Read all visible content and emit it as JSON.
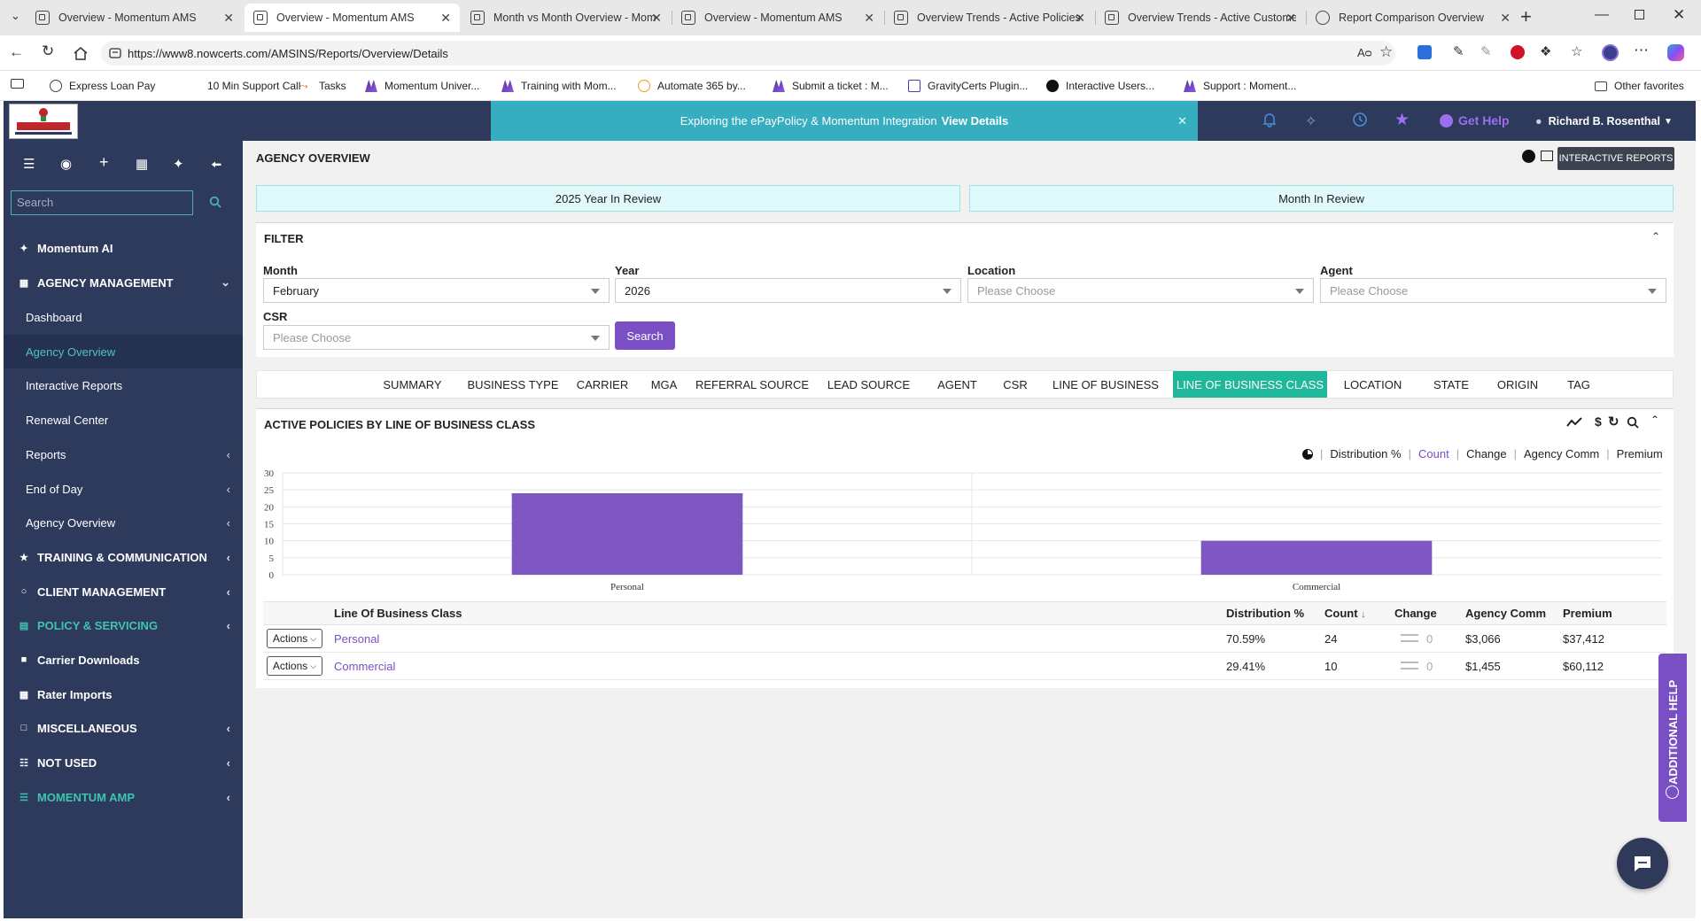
{
  "browser": {
    "tabs": [
      {
        "title": "Overview - Momentum AMS",
        "active": false
      },
      {
        "title": "Overview - Momentum AMS",
        "active": true
      },
      {
        "title": "Month vs Month Overview - Mom",
        "active": false
      },
      {
        "title": "Overview - Momentum AMS",
        "active": false
      },
      {
        "title": "Overview Trends - Active Policies",
        "active": false
      },
      {
        "title": "Overview Trends - Active Custome",
        "active": false
      },
      {
        "title": "Report Comparison Overview",
        "active": false
      }
    ],
    "url": "https://www8.nowcerts.com/AMSINS/Reports/Overview/Details",
    "favorites": [
      "Express Loan Pay",
      "10 Min Support Call",
      "Tasks",
      "Momentum Univer...",
      "Training with Mom...",
      "Automate 365 by...",
      "Submit a ticket : M...",
      "GravityCerts Plugin...",
      "Interactive Users...",
      "Support : Moment..."
    ],
    "other_favorites": "Other favorites"
  },
  "sidebar": {
    "search_placeholder": "Search",
    "items": [
      {
        "label": "Momentum AI",
        "type": "section",
        "icon": "sparkle-icon"
      },
      {
        "label": "AGENCY MANAGEMENT",
        "type": "section",
        "icon": "grid-icon",
        "chevron": "down"
      },
      {
        "label": "Dashboard",
        "type": "sub"
      },
      {
        "label": "Agency Overview",
        "type": "sub",
        "selected": true
      },
      {
        "label": "Interactive Reports",
        "type": "sub"
      },
      {
        "label": "Renewal Center",
        "type": "sub"
      },
      {
        "label": "Reports",
        "type": "sub",
        "chevron": "left"
      },
      {
        "label": "End of Day",
        "type": "sub",
        "chevron": "left"
      },
      {
        "label": "Agency Overview",
        "type": "sub",
        "chevron": "left"
      },
      {
        "label": "TRAINING & COMMUNICATION",
        "type": "section",
        "icon": "trophy-icon",
        "chevron": "left"
      },
      {
        "label": "CLIENT MANAGEMENT",
        "type": "section",
        "icon": "circle-icon",
        "chevron": "left"
      },
      {
        "label": "POLICY & SERVICING",
        "type": "section",
        "icon": "document-icon",
        "chevron": "left",
        "teal": true
      },
      {
        "label": "Carrier Downloads",
        "type": "section",
        "icon": "file-icon"
      },
      {
        "label": "Rater Imports",
        "type": "section",
        "icon": "calculator-icon"
      },
      {
        "label": "MISCELLANEOUS",
        "type": "section",
        "icon": "copy-icon",
        "chevron": "left"
      },
      {
        "label": "NOT USED",
        "type": "section",
        "icon": "sitemap-icon",
        "chevron": "left"
      },
      {
        "label": "MOMENTUM AMP",
        "type": "section",
        "icon": "list-icon",
        "chevron": "left",
        "teal": true
      }
    ]
  },
  "topbar": {
    "banner_text": "Exploring the ePayPolicy & Momentum Integration",
    "banner_link": "View Details",
    "get_help": "Get Help",
    "user": "Richard B. Rosenthal"
  },
  "page": {
    "title": "AGENCY OVERVIEW",
    "interactive_reports_btn": "INTERACTIVE REPORTS",
    "year_review": "2025 Year In Review",
    "month_review": "Month In Review"
  },
  "filter": {
    "title": "FILTER",
    "month_label": "Month",
    "month_value": "February",
    "year_label": "Year",
    "year_value": "2026",
    "location_label": "Location",
    "location_placeholder": "Please Choose",
    "agent_label": "Agent",
    "agent_placeholder": "Please Choose",
    "csr_label": "CSR",
    "csr_placeholder": "Please Choose",
    "search_btn": "Search"
  },
  "report_tabs": [
    "SUMMARY",
    "BUSINESS TYPE",
    "CARRIER",
    "MGA",
    "REFERRAL SOURCE",
    "LEAD SOURCE",
    "AGENT",
    "CSR",
    "LINE OF BUSINESS",
    "LINE OF BUSINESS CLASS",
    "LOCATION",
    "STATE",
    "ORIGIN",
    "TAG"
  ],
  "active_tab": "LINE OF BUSINESS CLASS",
  "chart_panel": {
    "title": "ACTIVE POLICIES BY LINE OF BUSINESS CLASS",
    "metrics": [
      "Distribution %",
      "Count",
      "Change",
      "Agency Comm",
      "Premium"
    ],
    "active_metric": "Count"
  },
  "chart_data": {
    "type": "bar",
    "categories": [
      "Personal",
      "Commercial"
    ],
    "values": [
      24,
      10
    ],
    "ylim": [
      0,
      30
    ],
    "yticks": [
      0,
      5,
      10,
      15,
      20,
      25,
      30
    ],
    "bar_color": "#7e57c2",
    "grid": true
  },
  "table": {
    "headers": {
      "lob": "Line Of Business Class",
      "dist": "Distribution %",
      "count": "Count",
      "change": "Change",
      "comm": "Agency Comm",
      "premium": "Premium"
    },
    "actions_label": "Actions",
    "rows": [
      {
        "lob": "Personal",
        "dist": "70.59%",
        "count": "24",
        "change": "0",
        "comm": "$3,066",
        "premium": "$37,412"
      },
      {
        "lob": "Commercial",
        "dist": "29.41%",
        "count": "10",
        "change": "0",
        "comm": "$1,455",
        "premium": "$60,112"
      }
    ]
  },
  "additional_help": "ADDITIONAL HELP",
  "colors": {
    "accent_purple": "#7b4fc4",
    "teal": "#1fb89a",
    "sidebar": "#2d3a5c",
    "banner": "#36aec0"
  }
}
